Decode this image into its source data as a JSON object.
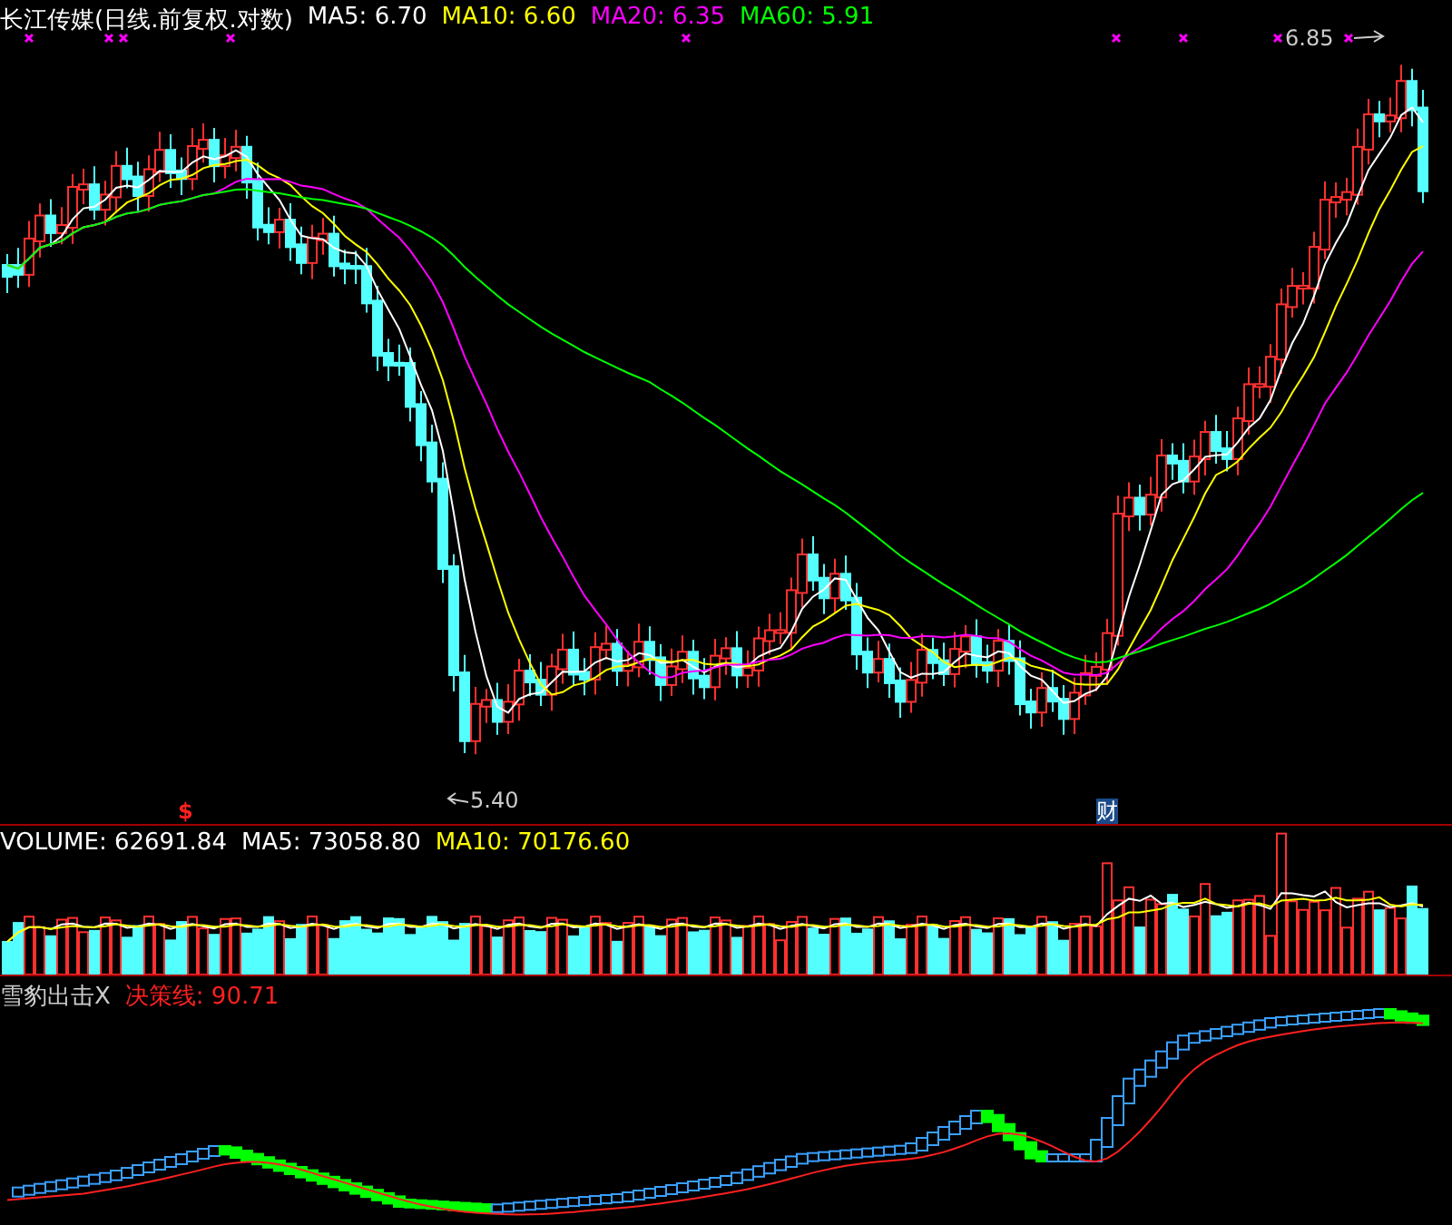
{
  "price_panel": {
    "title": "长江传媒(日线.前复权.对数)",
    "legend": [
      {
        "label": "MA5: 6.70",
        "color": "#ffffff"
      },
      {
        "label": "MA10: 6.60",
        "color": "#ffff00"
      },
      {
        "label": "MA20: 6.35",
        "color": "#ff00ff"
      },
      {
        "label": "MA60: 5.91",
        "color": "#00ff00"
      }
    ],
    "high_label": "6.85",
    "low_label": "5.40",
    "markers": [
      {
        "label": "$",
        "kind": "dollar"
      },
      {
        "label": "财",
        "kind": "finance"
      }
    ]
  },
  "volume_panel": {
    "legend": [
      {
        "label": "VOLUME: 62691.84",
        "color": "#ffffff"
      },
      {
        "label": "MA5: 73058.80",
        "color": "#ffffff"
      },
      {
        "label": "MA10: 70176.60",
        "color": "#ffff00"
      }
    ]
  },
  "indicator_panel": {
    "title": "雪豹出击X",
    "legend": [
      {
        "label": "决策线: 90.71",
        "color": "#ff2020"
      }
    ]
  }
}
